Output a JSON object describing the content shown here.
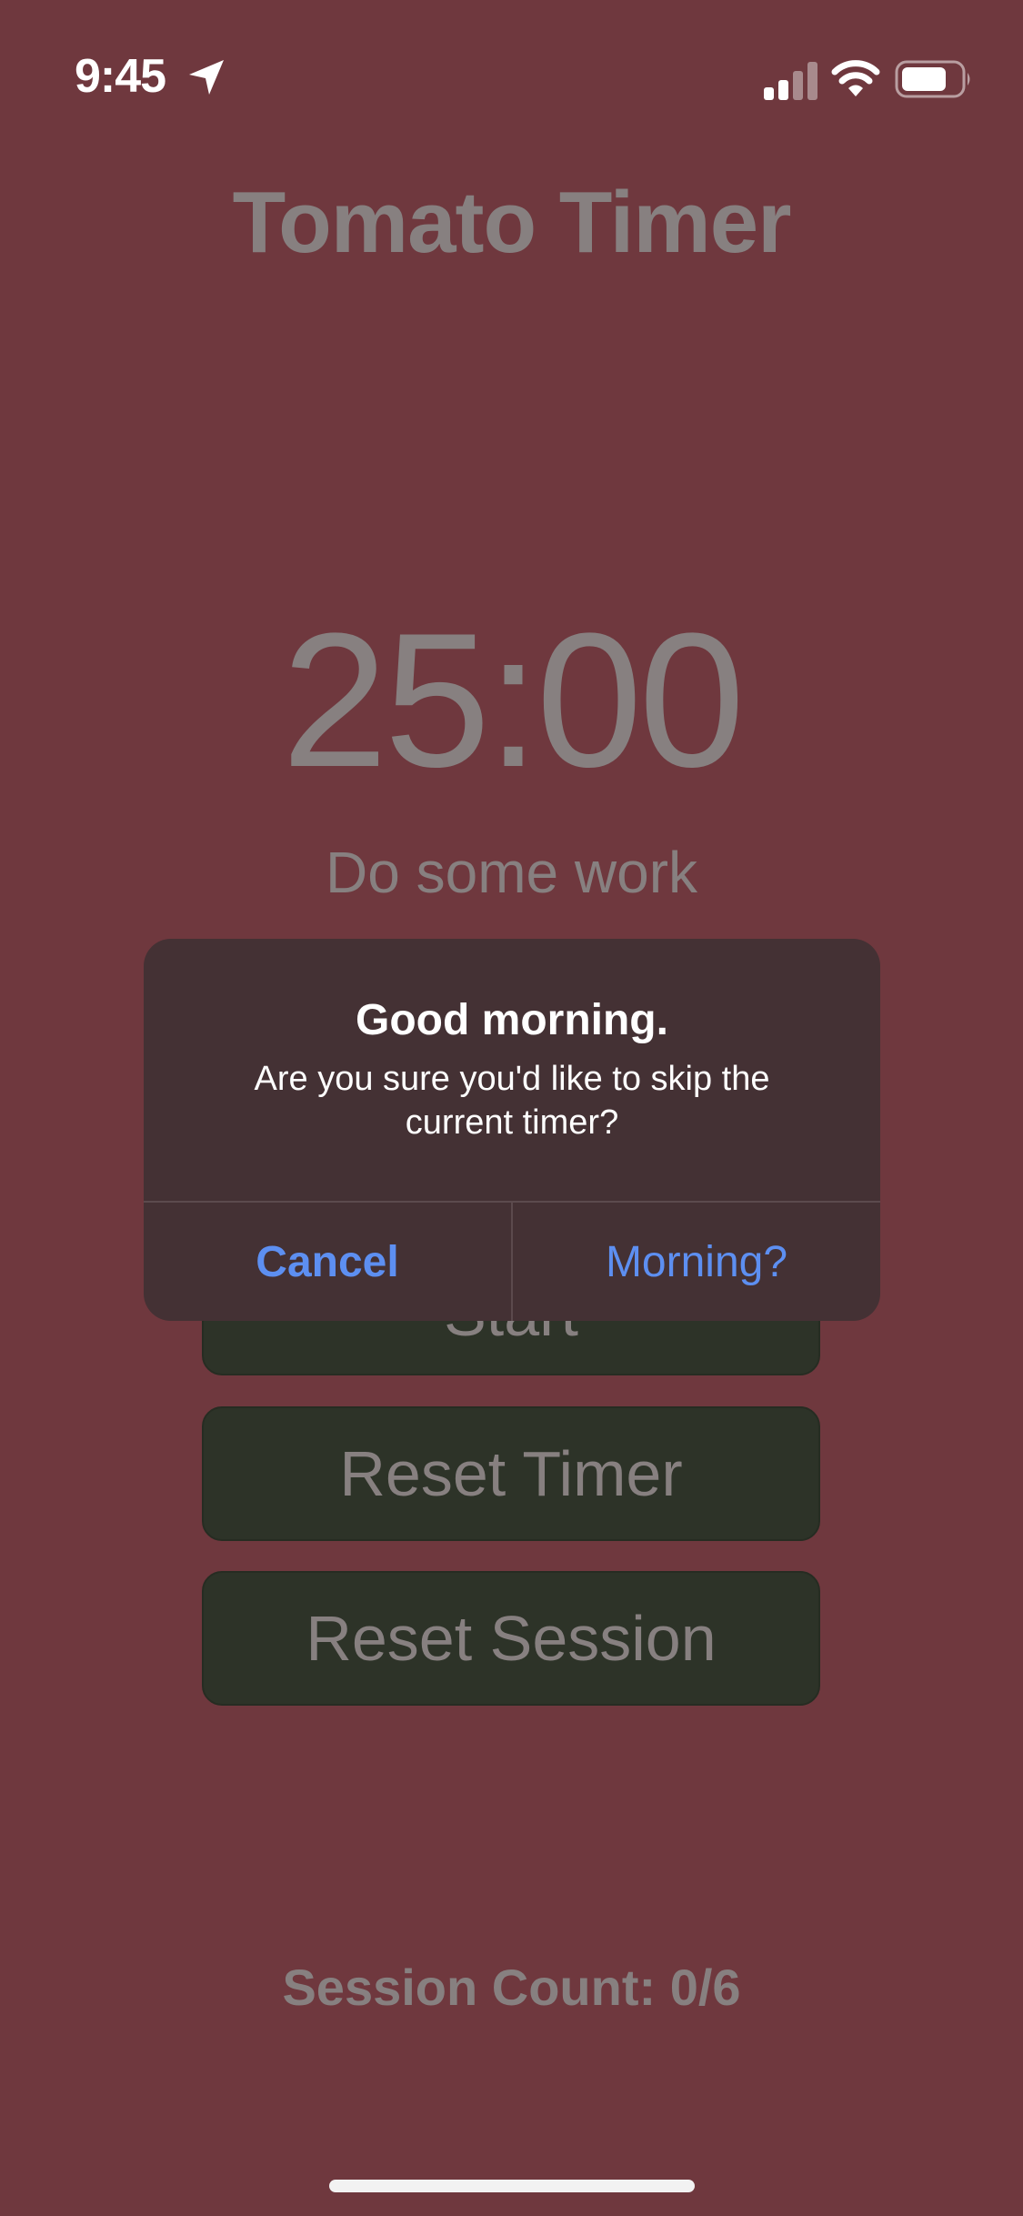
{
  "status_bar": {
    "time": "9:45",
    "icons": [
      "location-arrow-icon",
      "cellular-signal-icon",
      "wifi-icon",
      "battery-icon"
    ]
  },
  "app": {
    "title": "Tomato Timer",
    "timer": "25:00",
    "subtitle": "Do some work",
    "buttons": {
      "start": "Start",
      "reset_timer": "Reset Timer",
      "reset_session": "Reset Session"
    },
    "session_count": "Session Count: 0/6"
  },
  "alert": {
    "title": "Good morning.",
    "message": "Are you sure you'd like to skip the current timer?",
    "cancel_label": "Cancel",
    "confirm_label": "Morning?"
  },
  "colors": {
    "background": "#6f383e",
    "button_fill": "#2d3328",
    "alert_background": "#443134",
    "alert_action": "#5d8ff1",
    "dimmed_text": "#878080"
  }
}
